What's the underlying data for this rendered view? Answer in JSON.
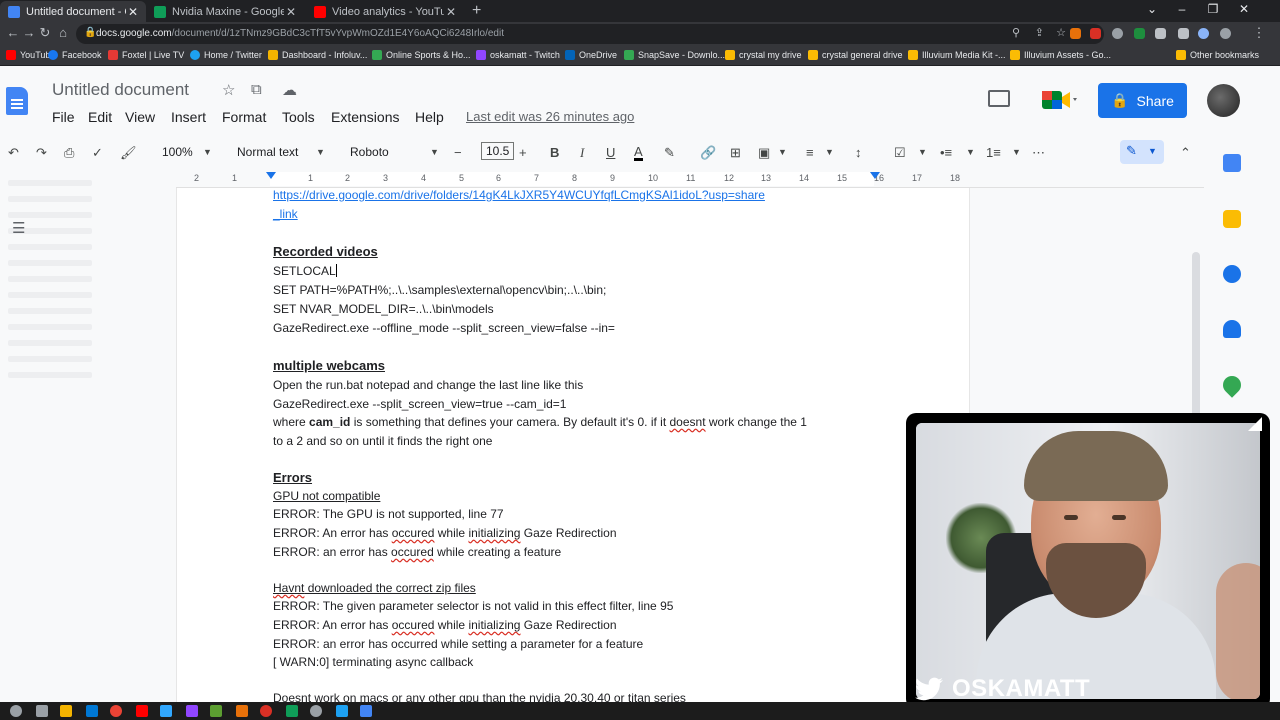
{
  "browser": {
    "tabs": [
      {
        "title": "Untitled document - Google Doc",
        "active": true,
        "color": "#4285f4"
      },
      {
        "title": "Nvidia Maxine - Google Drive",
        "active": false,
        "color": "#0f9d58"
      },
      {
        "title": "Video analytics - YouTube Studio",
        "active": false,
        "color": "#ff0000"
      }
    ],
    "url_host": "docs.google.com",
    "url_path": "/document/d/1zTNmz9GBdC3cTfT5vYvpWmOZd1E4Y6oAQCi6248Irlo/edit",
    "bookmarks": [
      {
        "label": "YouTube",
        "color": "#ff0000"
      },
      {
        "label": "Facebook",
        "color": "#1877f2"
      },
      {
        "label": "Foxtel | Live TV",
        "color": "#e53935"
      },
      {
        "label": "Home / Twitter",
        "color": "#1da1f2"
      },
      {
        "label": "Dashboard - Infoluv...",
        "color": "#f4b400"
      },
      {
        "label": "Online Sports & Ho...",
        "color": "#34a853"
      },
      {
        "label": "oskamatt - Twitch",
        "color": "#9146ff"
      },
      {
        "label": "OneDrive",
        "color": "#0364b8"
      },
      {
        "label": "SnapSave - Downlo...",
        "color": "#34a853"
      },
      {
        "label": "crystal my drive",
        "color": "#fbbc04"
      },
      {
        "label": "crystal general drive",
        "color": "#fbbc04"
      },
      {
        "label": "Illuvium Media Kit -...",
        "color": "#fbbc04"
      },
      {
        "label": "Illuvium Assets - Go...",
        "color": "#fbbc04"
      },
      {
        "label": "Other bookmarks",
        "color": "#fbbc04"
      }
    ]
  },
  "docs": {
    "title": "Untitled document",
    "menus": [
      "File",
      "Edit",
      "View",
      "Insert",
      "Format",
      "Tools",
      "Extensions",
      "Help"
    ],
    "last_edit": "Last edit was 26 minutes ago",
    "share_label": "Share",
    "toolbar": {
      "zoom": "100%",
      "style": "Normal text",
      "font": "Roboto",
      "font_size": "10.5"
    },
    "ruler_ticks": [
      "2",
      "1",
      "1",
      "2",
      "3",
      "4",
      "5",
      "6",
      "7",
      "8",
      "9",
      "10",
      "11",
      "12",
      "13",
      "14",
      "15",
      "16",
      "17",
      "18"
    ]
  },
  "document": {
    "link_line1": "https://drive.google.com/drive/folders/14gK4LkJXR5Y4WCUYfqfLCmgKSAl1idoL?usp=share",
    "link_line2": "_link",
    "h_recorded": "Recorded videos",
    "setlocal": "SETLOCAL",
    "set_path": "SET PATH=%PATH%;..\\..\\samples\\external\\opencv\\bin;..\\..\\bin;",
    "set_nvar": "SET NVAR_MODEL_DIR=..\\..\\bin\\models",
    "gaze_cmd": "GazeRedirect.exe --offline_mode --split_screen_view=false  --in=",
    "h_webcams": "multiple webcams",
    "open_run": "Open the run.bat notepad and change the last line like this",
    "gaze_cam": "GazeRedirect.exe --split_screen_view=true --cam_id=1",
    "where_a": "where ",
    "where_b": "cam_id",
    "where_c": " is something that defines your camera. By default it's 0. if it ",
    "where_d": "doesnt",
    "where_e": " work change the 1",
    "to_a2": "to a 2 and so on until it finds the right one",
    "h_errors": "Errors",
    "gpu_nc": "GPU not compatible",
    "err1": "ERROR: The GPU is not supported, line 77",
    "err2_a": "ERROR: An error has ",
    "err2_b": "occured",
    "err2_c": " while ",
    "err2_d": "initializing",
    "err2_e": " Gaze Redirection",
    "err3_a": "ERROR: an error has ",
    "err3_b": "occured",
    "err3_c": " while creating a feature",
    "havnt_a": "Havnt",
    "havnt_b": " downloaded the correct zip files",
    "err4": "ERROR: The given parameter selector is not valid in this effect filter, line 95",
    "err5_a": "ERROR: An error has ",
    "err5_b": "occured",
    "err5_c": " while ",
    "err5_d": "initializing",
    "err5_e": " Gaze Redirection",
    "err6": "ERROR: an error has occurred while setting a parameter for a feature",
    "warn": "[ WARN:0] terminating async callback",
    "doesnt_work": "Doesnt work on macs or any other gpu than the nvidia  20,30,40 or titan series"
  },
  "webcam": {
    "channel_name": "OSKAMATT"
  },
  "colors": {
    "share_blue": "#1a73e8",
    "link_blue": "#1a73e8",
    "chrome_dark": "#202124"
  }
}
